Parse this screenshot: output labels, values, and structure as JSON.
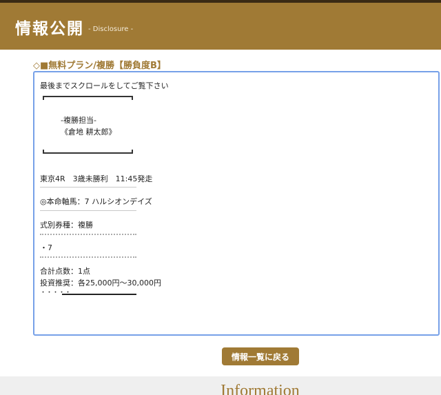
{
  "header": {
    "title": "情報公開",
    "subtitle": "- Disclosure -"
  },
  "plan": {
    "title": "◇■無料プラン/複勝【勝負度B】"
  },
  "content": {
    "intro": "最後までスクロールをしてご覧下さい",
    "author_role": "-複勝担当-",
    "author_name": "《倉地 耕太郎》",
    "race": "東京4R　3歳未勝利　11:45発走",
    "separator": "——————————————",
    "main_horse": "◎本命軸馬：7  ハルシオンデイズ",
    "bet_type": "式別券種：複勝",
    "pick": "・7",
    "total_points": "合計点数：1点",
    "investment": "投資推奨：各25,000円〜30,000円",
    "trailing": "・・・・・"
  },
  "back_button": {
    "label": "情報一覧に戻る"
  },
  "footer": {
    "section_title": "Information"
  },
  "colors": {
    "accent": "#a07a35",
    "focus_border": "#76a0e8"
  }
}
